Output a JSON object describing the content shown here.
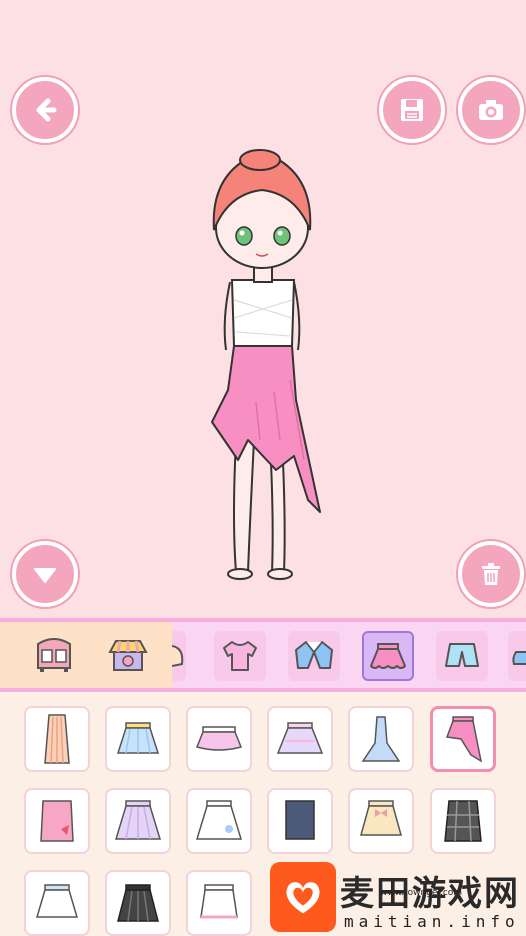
{
  "toolbar": {
    "back_icon": "arrow-left-icon",
    "save_icon": "floppy-disk-icon",
    "camera_icon": "camera-icon",
    "collapse_icon": "triangle-down-icon",
    "trash_icon": "trash-icon"
  },
  "categories": {
    "scenes": [
      "wardrobe-icon",
      "shop-icon"
    ],
    "items": [
      "hair-icon",
      "top-icon",
      "jacket-icon",
      "skirt-icon",
      "shorts-icon",
      "shoes-icon"
    ],
    "selected": "skirt-icon"
  },
  "items": {
    "selected_index": 5,
    "list": [
      "long-striped-skirt",
      "blue-pleated-skirt",
      "pink-tutu-skirt",
      "pastel-tulle-skirt",
      "blue-mermaid-skirt",
      "pink-asymmetric-skirt",
      "pink-bow-skirt",
      "lilac-flared-skirt",
      "white-flower-skirt",
      "navy-pencil-skirt",
      "cream-bow-skirt",
      "plaid-skirt",
      "white-lace-skirt",
      "black-pleated-skirt",
      "white-frill-skirt"
    ]
  },
  "watermark": {
    "title": "麦田游戏网",
    "url": "www.towngel.com",
    "sub": "maitian.info"
  },
  "colors": {
    "background": "#fde0e4",
    "button": "#f4a6bf",
    "category_bar": "#fbd6f3",
    "selected_tile": "#d9b8f5",
    "grid": "#fcefe6"
  }
}
